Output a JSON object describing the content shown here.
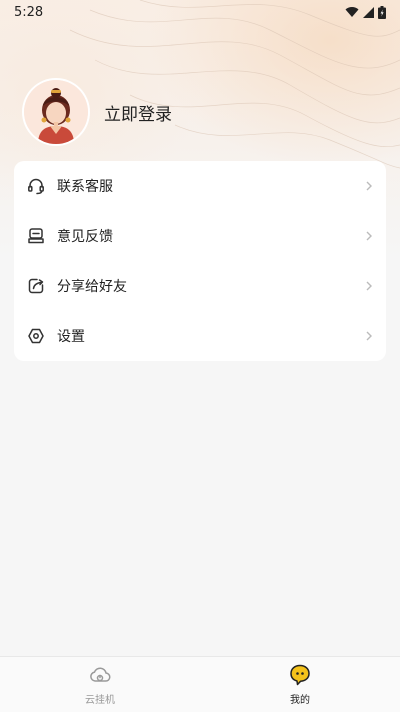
{
  "status_bar": {
    "time": "5:28",
    "icons": [
      "wifi-icon",
      "signal-icon",
      "battery-icon"
    ]
  },
  "profile": {
    "login_label": "立即登录"
  },
  "menu": {
    "items": [
      {
        "label": "联系客服",
        "icon": "headset-icon"
      },
      {
        "label": "意见反馈",
        "icon": "feedback-icon"
      },
      {
        "label": "分享给好友",
        "icon": "share-icon"
      },
      {
        "label": "设置",
        "icon": "settings-icon"
      }
    ]
  },
  "tab_bar": {
    "tabs": [
      {
        "label": "云挂机",
        "icon": "cloud-icon",
        "active": false
      },
      {
        "label": "我的",
        "icon": "mine-icon",
        "active": true
      }
    ]
  },
  "colors": {
    "accent": "#f4c21b",
    "text": "#222222",
    "muted": "#999999"
  }
}
